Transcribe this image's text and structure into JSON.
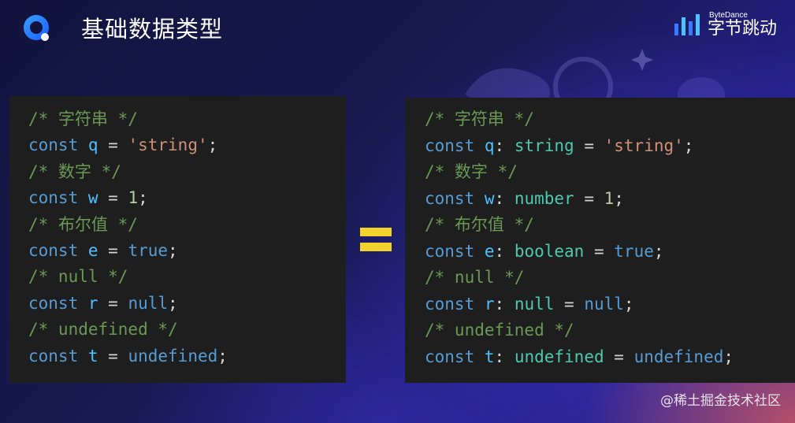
{
  "slide": {
    "title": "基础数据类型"
  },
  "brand": {
    "en": "ByteDance",
    "cn": "字节跳动"
  },
  "watermark": "@稀土掘金技术社区",
  "left_code": [
    [
      {
        "t": "/* 字符串 */",
        "c": "com"
      }
    ],
    [
      {
        "t": "const",
        "c": "kw"
      },
      {
        "t": " ",
        "c": "pun"
      },
      {
        "t": "q",
        "c": "var"
      },
      {
        "t": " = ",
        "c": "pun"
      },
      {
        "t": "'string'",
        "c": "str"
      },
      {
        "t": ";",
        "c": "pun"
      }
    ],
    [
      {
        "t": "/* 数字 */",
        "c": "com"
      }
    ],
    [
      {
        "t": "const",
        "c": "kw"
      },
      {
        "t": " ",
        "c": "pun"
      },
      {
        "t": "w",
        "c": "var"
      },
      {
        "t": " = ",
        "c": "pun"
      },
      {
        "t": "1",
        "c": "num"
      },
      {
        "t": ";",
        "c": "pun"
      }
    ],
    [
      {
        "t": "/* 布尔值 */",
        "c": "com"
      }
    ],
    [
      {
        "t": "const",
        "c": "kw"
      },
      {
        "t": " ",
        "c": "pun"
      },
      {
        "t": "e",
        "c": "var"
      },
      {
        "t": " = ",
        "c": "pun"
      },
      {
        "t": "true",
        "c": "kw"
      },
      {
        "t": ";",
        "c": "pun"
      }
    ],
    [
      {
        "t": "/* null */",
        "c": "com"
      }
    ],
    [
      {
        "t": "const",
        "c": "kw"
      },
      {
        "t": " ",
        "c": "pun"
      },
      {
        "t": "r",
        "c": "var"
      },
      {
        "t": " = ",
        "c": "pun"
      },
      {
        "t": "null",
        "c": "kw"
      },
      {
        "t": ";",
        "c": "pun"
      }
    ],
    [
      {
        "t": "/* undefined */",
        "c": "com"
      }
    ],
    [
      {
        "t": "const",
        "c": "kw"
      },
      {
        "t": " ",
        "c": "pun"
      },
      {
        "t": "t",
        "c": "var"
      },
      {
        "t": " = ",
        "c": "pun"
      },
      {
        "t": "undefined",
        "c": "kw"
      },
      {
        "t": ";",
        "c": "pun"
      }
    ]
  ],
  "right_code": [
    [
      {
        "t": "/* 字符串 */",
        "c": "com"
      }
    ],
    [
      {
        "t": "const",
        "c": "kw"
      },
      {
        "t": " ",
        "c": "pun"
      },
      {
        "t": "q",
        "c": "var"
      },
      {
        "t": ": ",
        "c": "pun"
      },
      {
        "t": "string",
        "c": "typ"
      },
      {
        "t": " = ",
        "c": "pun"
      },
      {
        "t": "'string'",
        "c": "str"
      },
      {
        "t": ";",
        "c": "pun"
      }
    ],
    [
      {
        "t": "/* 数字 */",
        "c": "com"
      }
    ],
    [
      {
        "t": "const",
        "c": "kw"
      },
      {
        "t": " ",
        "c": "pun"
      },
      {
        "t": "w",
        "c": "var"
      },
      {
        "t": ": ",
        "c": "pun"
      },
      {
        "t": "number",
        "c": "typ"
      },
      {
        "t": " = ",
        "c": "pun"
      },
      {
        "t": "1",
        "c": "num"
      },
      {
        "t": ";",
        "c": "pun"
      }
    ],
    [
      {
        "t": "/* 布尔值 */",
        "c": "com"
      }
    ],
    [
      {
        "t": "const",
        "c": "kw"
      },
      {
        "t": " ",
        "c": "pun"
      },
      {
        "t": "e",
        "c": "var"
      },
      {
        "t": ": ",
        "c": "pun"
      },
      {
        "t": "boolean",
        "c": "typ"
      },
      {
        "t": " = ",
        "c": "pun"
      },
      {
        "t": "true",
        "c": "kw"
      },
      {
        "t": ";",
        "c": "pun"
      }
    ],
    [
      {
        "t": "/* null */",
        "c": "com"
      }
    ],
    [
      {
        "t": "const",
        "c": "kw"
      },
      {
        "t": " ",
        "c": "pun"
      },
      {
        "t": "r",
        "c": "var"
      },
      {
        "t": ": ",
        "c": "pun"
      },
      {
        "t": "null",
        "c": "typ"
      },
      {
        "t": " = ",
        "c": "pun"
      },
      {
        "t": "null",
        "c": "kw"
      },
      {
        "t": ";",
        "c": "pun"
      }
    ],
    [
      {
        "t": "/* undefined */",
        "c": "com"
      }
    ],
    [
      {
        "t": "const",
        "c": "kw"
      },
      {
        "t": " ",
        "c": "pun"
      },
      {
        "t": "t",
        "c": "var"
      },
      {
        "t": ": ",
        "c": "pun"
      },
      {
        "t": "undefined",
        "c": "typ"
      },
      {
        "t": " = ",
        "c": "pun"
      },
      {
        "t": "undefined",
        "c": "kw"
      },
      {
        "t": ";",
        "c": "pun"
      }
    ]
  ],
  "colors": {
    "comment": "#6a9955",
    "keyword": "#569cd6",
    "variable": "#4fc1ff",
    "type": "#4ec9b0",
    "string": "#ce9178",
    "number": "#b5cea8",
    "punctuation": "#d4d4d4",
    "equals_sign": "#f2d22c",
    "code_background": "#1e1e1e"
  },
  "icons": {
    "logo": "course-logo-icon",
    "brand": "bytedance-logo-icon",
    "equals": "equals-icon"
  }
}
